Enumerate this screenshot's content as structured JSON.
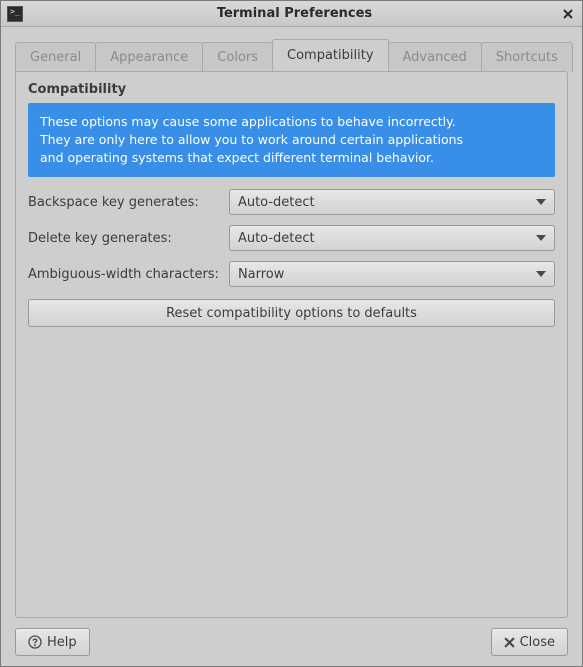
{
  "window": {
    "title": "Terminal Preferences"
  },
  "tabs": {
    "general": "General",
    "appearance": "Appearance",
    "colors": "Colors",
    "compatibility": "Compatibility",
    "advanced": "Advanced",
    "shortcuts": "Shortcuts"
  },
  "panel": {
    "heading": "Compatibility",
    "info": "These options may cause some applications to behave incorrectly.\nThey are only here to allow you to work around certain applications\nand operating systems that expect different terminal behavior.",
    "rows": {
      "backspace": {
        "label": "Backspace key generates:",
        "value": "Auto-detect"
      },
      "delete": {
        "label": "Delete key generates:",
        "value": "Auto-detect"
      },
      "ambwidth": {
        "label": "Ambiguous-width characters:",
        "value": "Narrow"
      }
    },
    "reset": "Reset compatibility options to defaults"
  },
  "footer": {
    "help": "Help",
    "close": "Close"
  },
  "colors": {
    "info_bg": "#398ee7"
  }
}
